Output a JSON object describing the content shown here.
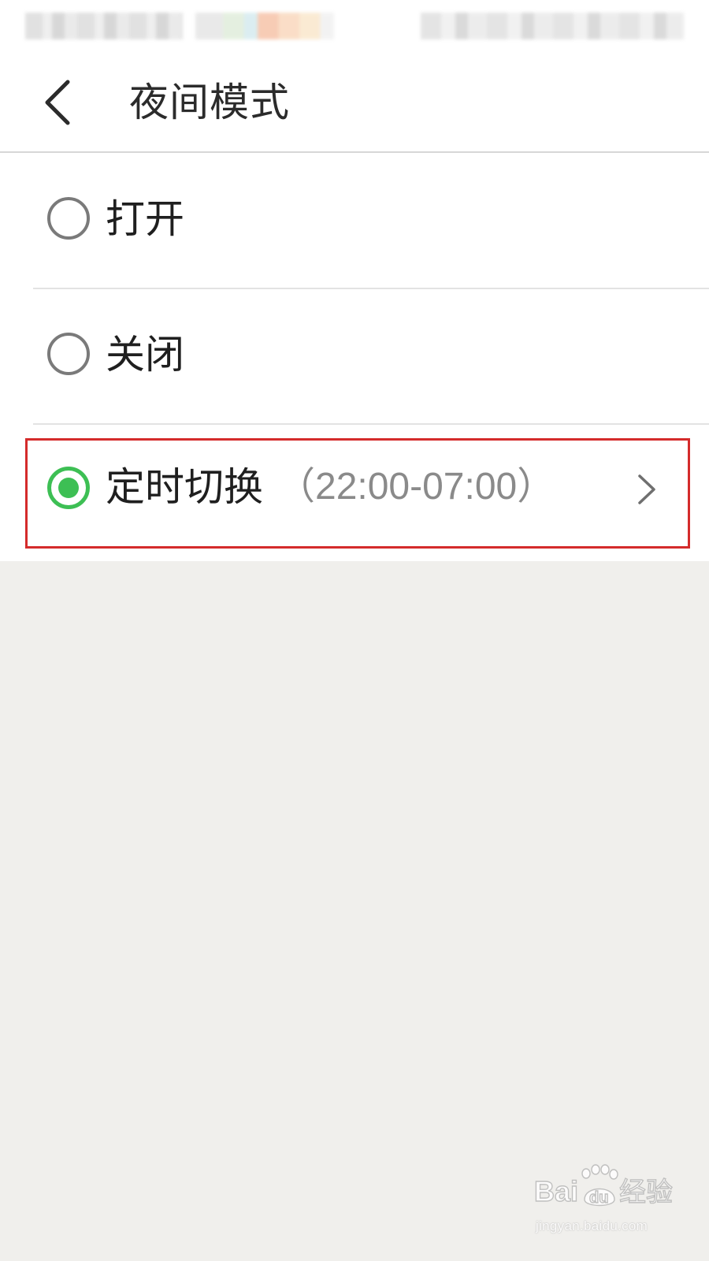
{
  "header": {
    "title": "夜间模式"
  },
  "options": [
    {
      "label": "打开",
      "selected": false
    },
    {
      "label": "关闭",
      "selected": false
    },
    {
      "label": "定时切换",
      "detail": "（22:00-07:00）",
      "selected": true
    }
  ],
  "watermark": {
    "logo_text": "Baidu经验",
    "domain": "jingyan.baidu.com"
  },
  "colors": {
    "accent_green": "#3dbf54",
    "highlight_red": "#d42b2b",
    "page_background": "#f0efec"
  },
  "icons": {
    "back": "chevron-left-icon",
    "forward": "chevron-right-icon"
  }
}
